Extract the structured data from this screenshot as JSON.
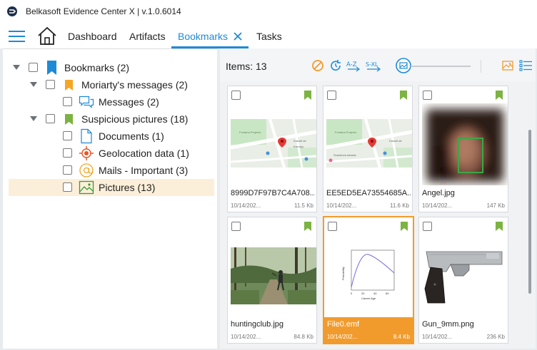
{
  "app": {
    "title": "Belkasoft Evidence Center X | v.1.0.6014"
  },
  "tabs": [
    {
      "label": "Dashboard"
    },
    {
      "label": "Artifacts"
    },
    {
      "label": "Bookmarks"
    },
    {
      "label": "Tasks"
    }
  ],
  "tree": {
    "root": {
      "label": "Bookmarks (2)"
    },
    "moriarty": {
      "label": "Moriarty's messages (2)"
    },
    "messages": {
      "label": "Messages (2)"
    },
    "suspicious": {
      "label": "Suspicious pictures (18)"
    },
    "documents": {
      "label": "Documents (1)"
    },
    "geo": {
      "label": "Geolocation data (1)"
    },
    "mails": {
      "label": "Mails - Important (3)"
    },
    "pictures": {
      "label": "Pictures (13)"
    }
  },
  "toolbar": {
    "items_label": "Items: 13",
    "sort_az": "A-Z",
    "sort_size": "S-XL"
  },
  "cards": [
    {
      "name": "8999D7F97B7C4A708...",
      "date": "10/14/202...",
      "size": "11.5 Kb"
    },
    {
      "name": "EE5ED5EA73554685A...",
      "date": "10/14/202...",
      "size": "11.6 Kb"
    },
    {
      "name": "Angel.jpg",
      "date": "10/14/202...",
      "size": "147 Kb"
    },
    {
      "name": "huntingclub.jpg",
      "date": "10/14/202...",
      "size": "84.8 Kb"
    },
    {
      "name": "File0.emf",
      "date": "10/14/202...",
      "size": "8.4 Kb"
    },
    {
      "name": "Gun_9mm.png",
      "date": "10/14/202...",
      "size": "236 Kb"
    }
  ],
  "map_labels": {
    "park": "Fontana Projects",
    "street": "Svandova strasse",
    "place": "Kreuzig",
    "road": "Hausgasse 3",
    "small": "Kasold str"
  },
  "chart_thumb": {
    "ylabel": "Probability",
    "xlabel": "Career Age",
    "xticks": [
      "0",
      "20",
      "40",
      "60"
    ]
  },
  "colors": {
    "accent": "#1e8ad6",
    "bookmark_green": "#7cb342",
    "bookmark_orange": "#f5a623",
    "selection": "#f29b2d"
  }
}
